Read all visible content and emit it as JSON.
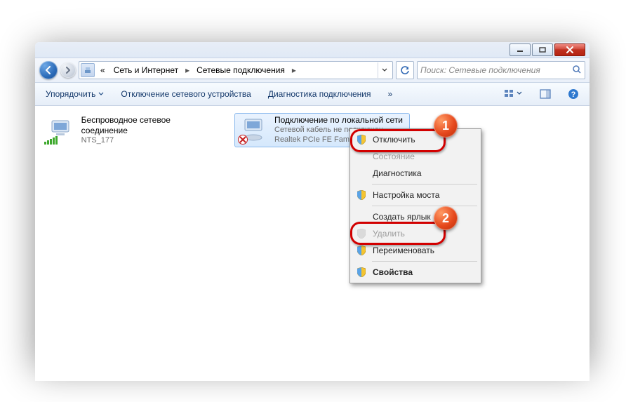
{
  "window": {
    "minimize": "minimize",
    "maximize": "maximize",
    "close": "close"
  },
  "address": {
    "ellipsis": "«",
    "seg1": "Сеть и Интернет",
    "seg2": "Сетевые подключения"
  },
  "search": {
    "placeholder": "Поиск: Сетевые подключения"
  },
  "toolbar": {
    "organize": "Упорядочить",
    "disable_device": "Отключение сетевого устройства",
    "diagnose": "Диагностика подключения",
    "more": "»"
  },
  "connections": [
    {
      "title": "Беспроводное сетевое соединение",
      "sub1": "",
      "sub2": "NTS_177"
    },
    {
      "title": "Подключение по локальной сети",
      "sub1": "Сетевой кабель не подключен",
      "sub2": "Realtek PCIe FE Family"
    }
  ],
  "context_menu": {
    "disable": "Отключить",
    "status": "Состояние",
    "diagnose": "Диагностика",
    "bridge": "Настройка моста",
    "create_shortcut": "Создать ярлык",
    "delete": "Удалить",
    "rename": "Переименовать",
    "properties": "Свойства"
  },
  "callouts": {
    "one": "1",
    "two": "2"
  }
}
